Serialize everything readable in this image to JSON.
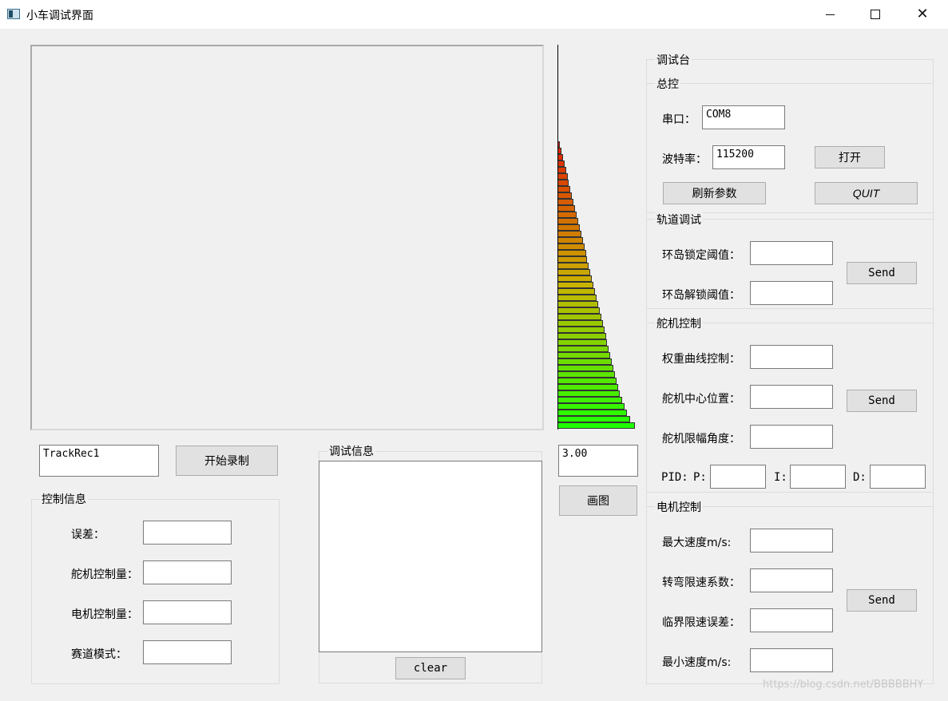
{
  "window": {
    "title": "小车调试界面"
  },
  "left": {
    "record_name": "TrackRec1",
    "record_button": "开始录制",
    "control_group_title": "控制信息",
    "control_fields": [
      {
        "label": "误差：",
        "value": ""
      },
      {
        "label": "舵机控制量：",
        "value": ""
      },
      {
        "label": "电机控制量：",
        "value": ""
      },
      {
        "label": "赛道模式：",
        "value": ""
      }
    ]
  },
  "debug": {
    "group_title": "调试信息",
    "text": "",
    "clear_button": "clear"
  },
  "histogram": {
    "value_field": "3.00",
    "plot_button": "画图",
    "bar_fractions": [
      0.02,
      0.04,
      0.06,
      0.08,
      0.1,
      0.12,
      0.14,
      0.16,
      0.18,
      0.2,
      0.22,
      0.24,
      0.26,
      0.28,
      0.3,
      0.32,
      0.34,
      0.36,
      0.38,
      0.4,
      0.42,
      0.44,
      0.46,
      0.48,
      0.5,
      0.52,
      0.54,
      0.56,
      0.58,
      0.6,
      0.62,
      0.64,
      0.66,
      0.68,
      0.7,
      0.72,
      0.74,
      0.76,
      0.78,
      0.8,
      0.83,
      0.86,
      0.9,
      0.94,
      1.0
    ]
  },
  "console": {
    "title": "调试台",
    "master": {
      "title": "总控",
      "port_label": "串口：",
      "port_value": "COM8",
      "baud_label": "波特率：",
      "baud_value": "115200",
      "open_button": "打开",
      "refresh_button": "刷新参数",
      "quit_button": "QUIT"
    },
    "track": {
      "title": "轨道调试",
      "fields": [
        {
          "label": "环岛锁定阈值：",
          "value": ""
        },
        {
          "label": "环岛解锁阈值：",
          "value": ""
        }
      ],
      "send_button": "Send"
    },
    "servo": {
      "title": "舵机控制",
      "fields": [
        {
          "label": "权重曲线控制：",
          "value": ""
        },
        {
          "label": "舵机中心位置：",
          "value": ""
        },
        {
          "label": "舵机限幅角度：",
          "value": ""
        }
      ],
      "send_button": "Send",
      "pid_prefix": "PID:",
      "p_label": "P:",
      "i_label": "I:",
      "d_label": "D:",
      "p_value": "",
      "i_value": "",
      "d_value": ""
    },
    "motor": {
      "title": "电机控制",
      "fields": [
        {
          "label": "最大速度m/s:",
          "value": ""
        },
        {
          "label": "转弯限速系数：",
          "value": ""
        },
        {
          "label": "临界限速误差：",
          "value": ""
        },
        {
          "label": "最小速度m/s:",
          "value": ""
        }
      ],
      "send_button": "Send"
    }
  },
  "watermark": "https://blog.csdn.net/BBBBBHY",
  "colors": {
    "bar_top": "#e02000",
    "bar_mid": "#c8b400",
    "bar_bottom": "#20ff00"
  }
}
